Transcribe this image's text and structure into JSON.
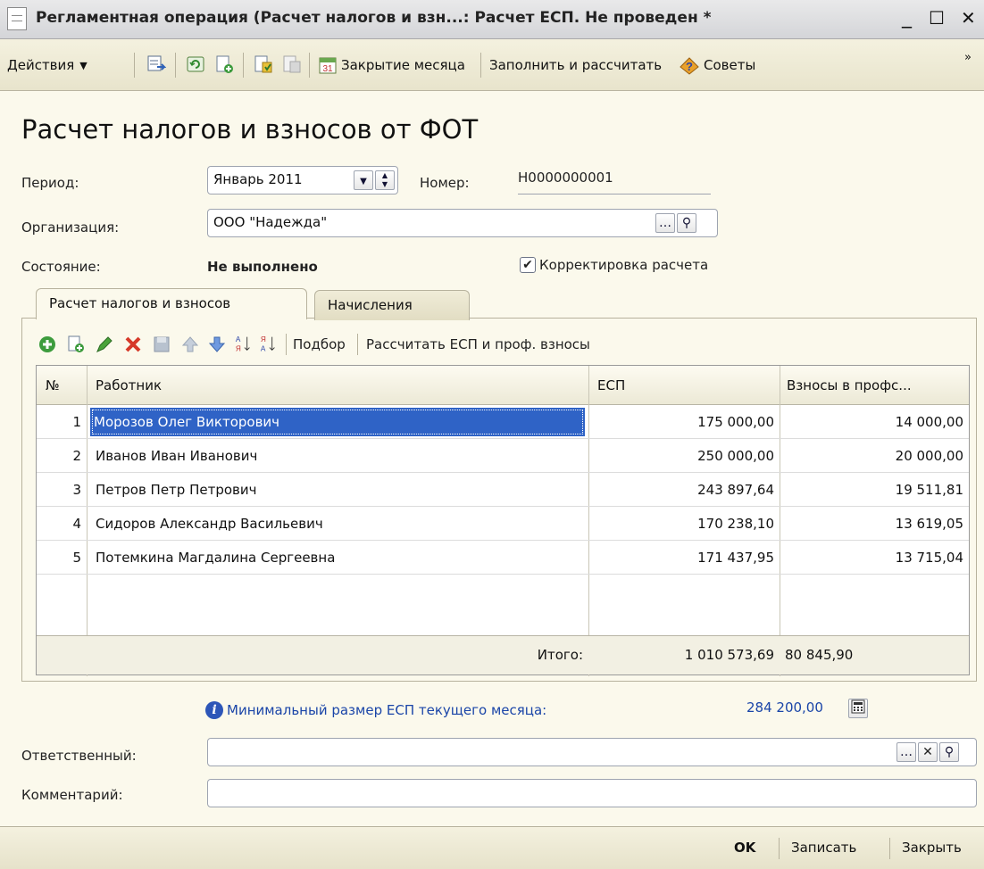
{
  "window": {
    "title": "Регламентная операция (Расчет налогов и взн...: Расчет ЕСП. Не проведен *",
    "minimize": "_",
    "maximize": "☐",
    "close": "✕"
  },
  "toolbar": {
    "actions_label": "Действия",
    "close_month_label": "Закрытие месяца",
    "fill_calc_label": "Заполнить и рассчитать",
    "tips_label": "Советы",
    "more": "»"
  },
  "form": {
    "title": "Расчет налогов и взносов от ФОТ",
    "period_label": "Период:",
    "period_value": "Январь 2011",
    "number_label": "Номер:",
    "number_value": "Н0000000001",
    "org_label": "Организация:",
    "org_value": "ООО \"Надежда\"",
    "state_label": "Состояние:",
    "state_value": "Не выполнено",
    "correction_label": "Корректировка расчета",
    "correction_checked": true
  },
  "tabs": [
    {
      "label": "Расчет налогов и взносов",
      "active": true
    },
    {
      "label": "Начисления",
      "active": false
    }
  ],
  "table_toolbar": {
    "pick_label": "Подбор",
    "calc_label": "Рассчитать ЕСП и проф. взносы"
  },
  "table": {
    "columns": [
      "№",
      "Работник",
      "ЕСП",
      "Взносы в профс..."
    ],
    "rows": [
      {
        "n": "1",
        "worker": "Морозов Олег Викторович",
        "esp": "175 000,00",
        "contrib": "14 000,00",
        "selected": true
      },
      {
        "n": "2",
        "worker": "Иванов Иван Иванович",
        "esp": "250 000,00",
        "contrib": "20 000,00",
        "selected": false
      },
      {
        "n": "3",
        "worker": "Петров Петр Петрович",
        "esp": "243 897,64",
        "contrib": "19 511,81",
        "selected": false
      },
      {
        "n": "4",
        "worker": "Сидоров  Александр Васильевич",
        "esp": "170 238,10",
        "contrib": "13 619,05",
        "selected": false
      },
      {
        "n": "5",
        "worker": "Потемкина Магдалина Сергеевна",
        "esp": "171 437,95",
        "contrib": "13 715,04",
        "selected": false
      }
    ],
    "total_label": "Итого:",
    "total_esp": "1 010 573,69",
    "total_contrib": "80 845,90"
  },
  "min_esp": {
    "label": "Минимальный размер ЕСП текущего месяца:",
    "value": "284 200,00"
  },
  "responsible": {
    "label": "Ответственный:",
    "value": ""
  },
  "comment": {
    "label": "Комментарий:",
    "value": ""
  },
  "footer": {
    "ok_label": "OK",
    "save_label": "Записать",
    "close_label": "Закрыть"
  },
  "colors": {
    "background": "#fbf9ec",
    "selection": "#2f63c6",
    "link_blue": "#1a45a8"
  }
}
